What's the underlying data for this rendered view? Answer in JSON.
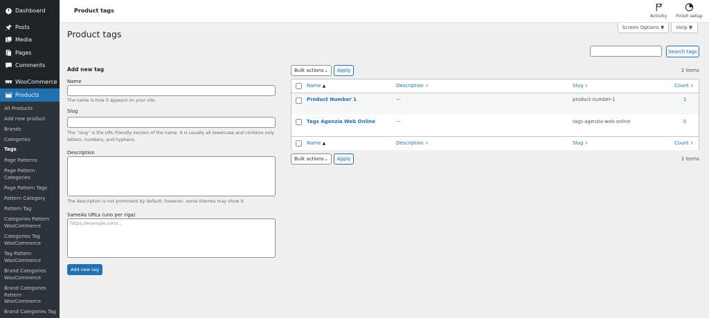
{
  "sidebar": {
    "menu": [
      {
        "label": "Dashboard",
        "icon": "dashboard-icon"
      },
      {
        "label": "Posts",
        "icon": "pin-icon"
      },
      {
        "label": "Media",
        "icon": "media-icon"
      },
      {
        "label": "Pages",
        "icon": "pages-icon"
      },
      {
        "label": "Comments",
        "icon": "comment-icon"
      },
      {
        "label": "WooCommerce",
        "icon": "woocommerce-icon"
      },
      {
        "label": "Products",
        "icon": "products-icon"
      }
    ],
    "submenu": [
      "All Products",
      "Add new product",
      "Brands",
      "Categories",
      "Tags",
      "Page Patterns",
      "Page Pattern Categories",
      "Page Pattern Tags",
      "Pattern Category",
      "Pattern Tag",
      "Categories Pattern WooCommerce",
      "Categories Tag WooCommerce",
      "Tag Pattern WooCommerce",
      "Brand Categories WooCommerce",
      "Brand Categories Pattern WooCommerce",
      "Brand Categories Tag"
    ]
  },
  "topbar": {
    "title": "Product tags",
    "activity": "Activity",
    "finish_setup": "Finish setup"
  },
  "screen_options": "Screen Options ▼",
  "help": "Help ▼",
  "page_title": "Product tags",
  "search": {
    "button": "Search tags",
    "value": ""
  },
  "form": {
    "title": "Add new tag",
    "name_label": "Name",
    "name_help": "The name is how it appears on your site.",
    "slug_label": "Slug",
    "slug_help": "The “slug” is the URL-friendly version of the name. It is usually all lowercase and contains only letters, numbers, and hyphens.",
    "desc_label": "Description",
    "desc_help": "The description is not prominent by default; however, some themes may show it.",
    "sameas_label": "SameAs URLs (uno per riga)",
    "sameas_placeholder": "https://example.com/...",
    "submit": "Add new tag"
  },
  "bulk": {
    "label": "Bulk actions",
    "apply": "Apply",
    "items": "2 items"
  },
  "table": {
    "headers": {
      "name": "Name",
      "description": "Description",
      "slug": "Slug",
      "count": "Count"
    },
    "rows": [
      {
        "name": "Product Number 1",
        "description": "—",
        "slug": "product-number-1",
        "count": "1"
      },
      {
        "name": "Tags Agenzia Web Online",
        "description": "—",
        "slug": "tags-agenzia-web-online",
        "count": "0"
      }
    ]
  },
  "colors": {
    "accent": "#2271b1",
    "sidebar": "#1d2327"
  }
}
